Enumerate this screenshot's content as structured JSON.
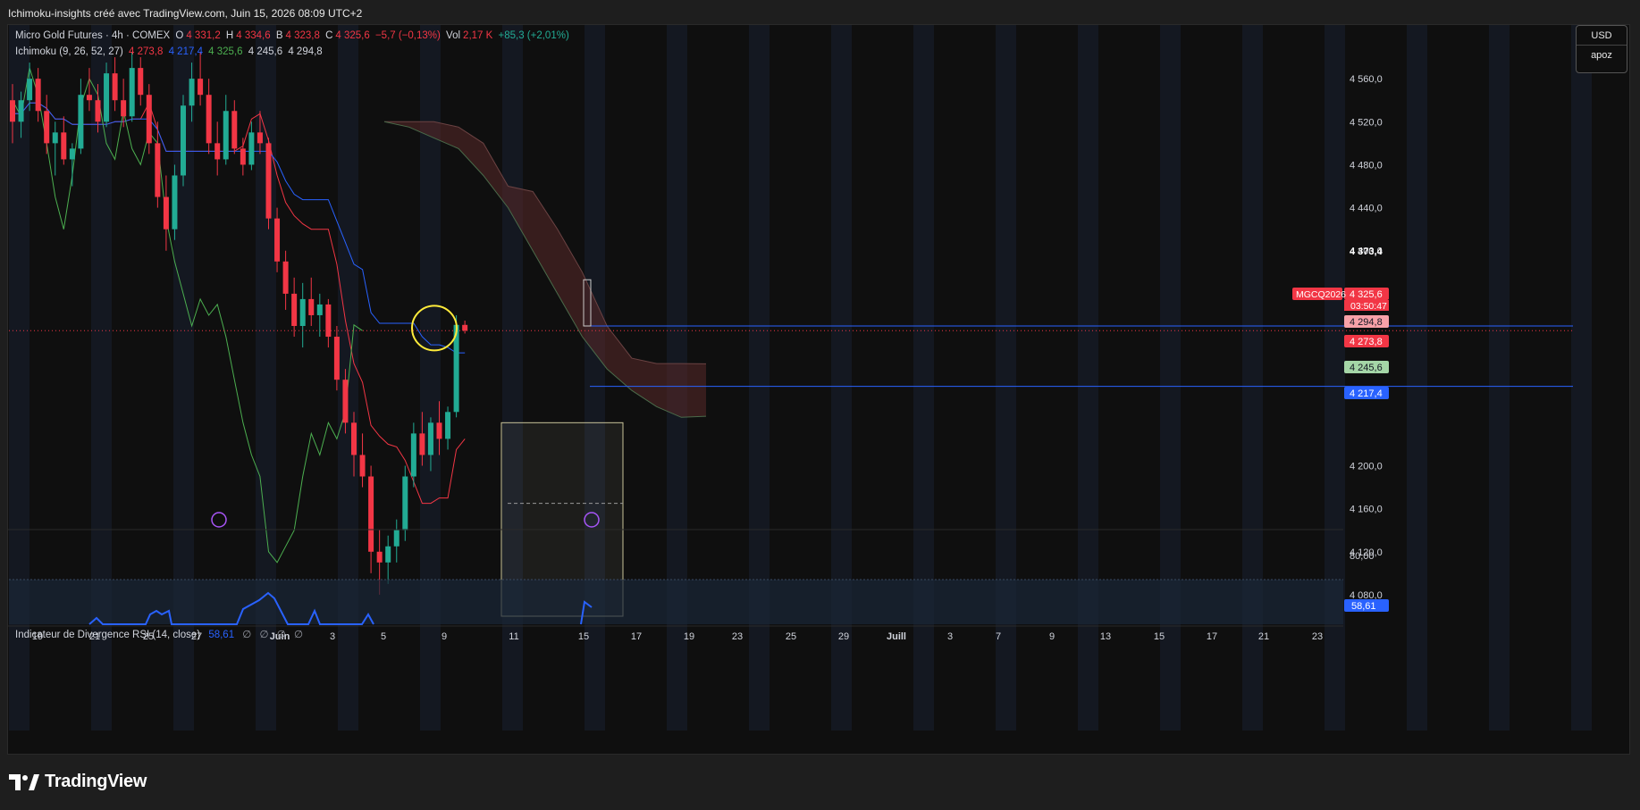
{
  "page_title": "Ichimoku-insights créé avec TradingView.com, Juin 15, 2026 08:09 UTC+2",
  "legend": {
    "symbol": "Micro Gold Futures · 4h · COMEX",
    "open_label": "O",
    "open": "4 331,2",
    "high_label": "H",
    "high": "4 334,6",
    "low_label": "B",
    "low": "4 323,8",
    "close_label": "C",
    "close": "4 325,6",
    "change": "−5,7 (−0,13%)",
    "vol_label": "Vol",
    "vol": "2,17 K",
    "vol_change": "+85,3 (+2,01%)",
    "ichimoku_title": "Ichimoku (9, 26, 52, 27)",
    "ichimoku_values": [
      {
        "value": "4 273,8",
        "color": "#f23645"
      },
      {
        "value": "4 217,4",
        "color": "#2962ff"
      },
      {
        "value": "4 325,6",
        "color": "#4caf50"
      },
      {
        "value": "4 245,6",
        "color": "#d1d4dc"
      },
      {
        "value": "4 294,8",
        "color": "#d1d4dc"
      }
    ]
  },
  "currency": {
    "code": "USD",
    "user": "apoz"
  },
  "rsi": {
    "title": "Indicateur de Divergence RSI (14, close)",
    "value": "58,61",
    "empty_values": [
      "∅",
      "∅",
      "∅",
      "∅"
    ]
  },
  "price_labels": [
    {
      "text": "4 560,0",
      "value": 4560
    },
    {
      "text": "4 520,0",
      "value": 4520
    },
    {
      "text": "4 480,0",
      "value": 4480
    },
    {
      "text": "4 440,0",
      "value": 4440
    },
    {
      "text": "4 400,0",
      "value": 4400
    },
    {
      "text": "4 360,0",
      "value": 4360
    },
    {
      "text": "4 200,0",
      "value": 4200
    },
    {
      "text": "4 160,0",
      "value": 4160
    },
    {
      "text": "4 120,0",
      "value": 4120
    },
    {
      "text": "4 080,0",
      "value": 4080
    }
  ],
  "price_badges": [
    {
      "text": "4 373,4",
      "value": 4373.4,
      "bg": "none",
      "fg": "#ffffff"
    },
    {
      "text": "4 325,6",
      "value": 4325.6,
      "bg": "#f23645",
      "fg": "#ffffff"
    },
    {
      "text": "4 294,8",
      "value": 4294.8,
      "bg": "#f7a1a8",
      "fg": "#131722"
    },
    {
      "text": "4 273,8",
      "value": 4273.8,
      "bg": "#f23645",
      "fg": "#ffffff"
    },
    {
      "text": "4 245,6",
      "value": 4245.6,
      "bg": "#a5d6a7",
      "fg": "#131722"
    },
    {
      "text": "4 217,4",
      "value": 4217.4,
      "bg": "#2962ff",
      "fg": "#ffffff"
    }
  ],
  "countdown": "03:50:47",
  "symbol_tag": "MGCQ2026",
  "rsi_labels": [
    {
      "text": "80,00",
      "value": 80
    }
  ],
  "rsi_badge": {
    "text": "58,61",
    "value": 58.61
  },
  "x_labels": [
    "19",
    "21",
    "25",
    "27",
    "Juin",
    "3",
    "5",
    "9",
    "11",
    "15",
    "17",
    "19",
    "23",
    "25",
    "29",
    "Juill",
    "3",
    "7",
    "9",
    "13",
    "15",
    "17",
    "21",
    "23"
  ],
  "brand": "TradingView",
  "colors": {
    "up": "#22ab94",
    "down": "#f23645",
    "tenkan": "#f23645",
    "kijun": "#2962ff",
    "chikou": "#4caf50",
    "cloud_bear": "#5a2a2a",
    "cloud_bull": "#2a4a2a"
  },
  "chart_data": {
    "type": "candlestick",
    "timeframe": "4h",
    "y_range": [
      4060,
      4600
    ],
    "x_dates": [
      "19",
      "21",
      "25",
      "27",
      "Juin",
      "3",
      "5",
      "9",
      "11",
      "15"
    ],
    "candles": [
      [
        4540,
        4555,
        4500,
        4520
      ],
      [
        4520,
        4548,
        4505,
        4540
      ],
      [
        4540,
        4575,
        4530,
        4560
      ],
      [
        4560,
        4570,
        4520,
        4530
      ],
      [
        4530,
        4545,
        4490,
        4500
      ],
      [
        4500,
        4520,
        4470,
        4510
      ],
      [
        4510,
        4525,
        4480,
        4485
      ],
      [
        4485,
        4500,
        4460,
        4495
      ],
      [
        4495,
        4560,
        4490,
        4545
      ],
      [
        4545,
        4570,
        4530,
        4540
      ],
      [
        4540,
        4555,
        4510,
        4520
      ],
      [
        4520,
        4575,
        4515,
        4565
      ],
      [
        4565,
        4580,
        4530,
        4540
      ],
      [
        4540,
        4560,
        4515,
        4525
      ],
      [
        4525,
        4585,
        4520,
        4570
      ],
      [
        4570,
        4580,
        4535,
        4545
      ],
      [
        4545,
        4555,
        4490,
        4500
      ],
      [
        4500,
        4520,
        4440,
        4450
      ],
      [
        4450,
        4470,
        4400,
        4420
      ],
      [
        4420,
        4480,
        4410,
        4470
      ],
      [
        4470,
        4545,
        4460,
        4535
      ],
      [
        4535,
        4575,
        4520,
        4560
      ],
      [
        4560,
        4585,
        4535,
        4545
      ],
      [
        4545,
        4560,
        4490,
        4500
      ],
      [
        4500,
        4520,
        4470,
        4485
      ],
      [
        4485,
        4545,
        4480,
        4530
      ],
      [
        4530,
        4540,
        4490,
        4495
      ],
      [
        4495,
        4505,
        4470,
        4480
      ],
      [
        4480,
        4520,
        4475,
        4510
      ],
      [
        4510,
        4530,
        4490,
        4500
      ],
      [
        4500,
        4505,
        4420,
        4430
      ],
      [
        4430,
        4440,
        4380,
        4390
      ],
      [
        4390,
        4400,
        4345,
        4360
      ],
      [
        4360,
        4375,
        4320,
        4330
      ],
      [
        4330,
        4370,
        4310,
        4355
      ],
      [
        4355,
        4375,
        4330,
        4340
      ],
      [
        4340,
        4360,
        4320,
        4350
      ],
      [
        4350,
        4355,
        4310,
        4320
      ],
      [
        4320,
        4330,
        4270,
        4280
      ],
      [
        4280,
        4290,
        4230,
        4240
      ],
      [
        4240,
        4250,
        4190,
        4210
      ],
      [
        4210,
        4230,
        4180,
        4190
      ],
      [
        4190,
        4200,
        4100,
        4120
      ],
      [
        4120,
        4140,
        4080,
        4110
      ],
      [
        4110,
        4135,
        4090,
        4125
      ],
      [
        4125,
        4150,
        4110,
        4140
      ],
      [
        4140,
        4200,
        4130,
        4190
      ],
      [
        4190,
        4240,
        4180,
        4230
      ],
      [
        4230,
        4250,
        4200,
        4210
      ],
      [
        4210,
        4245,
        4195,
        4240
      ],
      [
        4240,
        4260,
        4210,
        4225
      ],
      [
        4225,
        4255,
        4215,
        4250
      ],
      [
        4250,
        4340,
        4245,
        4331
      ],
      [
        4331,
        4335,
        4323,
        4325.6
      ]
    ],
    "ichimoku": {
      "tenkan": 4273.8,
      "kijun": 4217.4,
      "senkou_a": 4245.6,
      "senkou_b": 4294.8,
      "chikou": 4325.6
    },
    "last_price": 4325.6,
    "rsi_value": 58.61
  }
}
